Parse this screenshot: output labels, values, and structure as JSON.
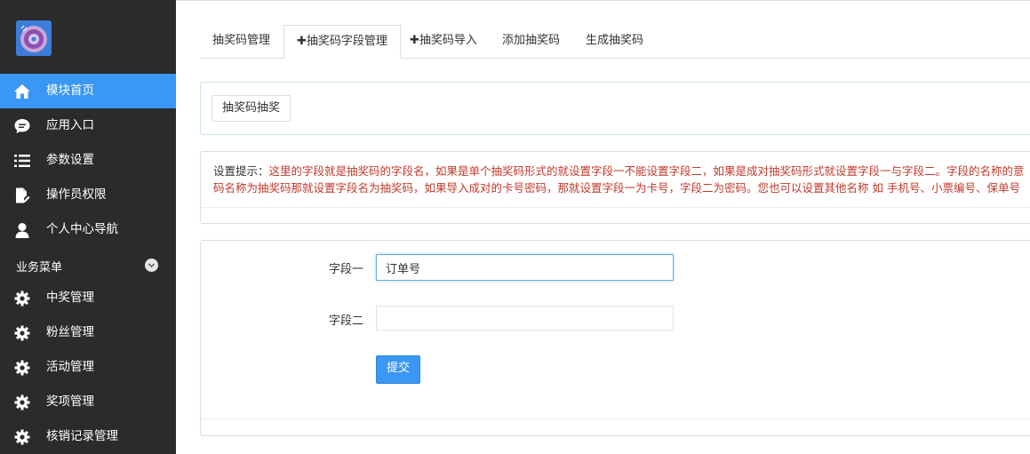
{
  "sidebar": {
    "items": [
      {
        "label": "模块首页",
        "icon": "home-icon",
        "active": true
      },
      {
        "label": "应用入口",
        "icon": "chat-icon"
      },
      {
        "label": "参数设置",
        "icon": "list-icon"
      },
      {
        "label": "操作员权限",
        "icon": "edit-doc-icon"
      },
      {
        "label": "个人中心导航",
        "icon": "user-icon"
      }
    ],
    "group": {
      "label": "业务菜单",
      "toggle_icon": "chevron-down-icon"
    },
    "group_items": [
      {
        "label": "中奖管理",
        "icon": "gear-icon"
      },
      {
        "label": "粉丝管理",
        "icon": "gear-icon"
      },
      {
        "label": "活动管理",
        "icon": "gear-icon"
      },
      {
        "label": "奖项管理",
        "icon": "gear-icon"
      },
      {
        "label": "核销记录管理",
        "icon": "gear-icon"
      }
    ]
  },
  "tabs": [
    {
      "label": "抽奖码管理"
    },
    {
      "label": "抽奖码字段管理",
      "plus": "✚",
      "active": true
    },
    {
      "label": "抽奖码导入",
      "plus": "✚"
    },
    {
      "label": "添加抽奖码"
    },
    {
      "label": "生成抽奖码"
    }
  ],
  "subbar": {
    "button_label": "抽奖码抽奖"
  },
  "hint": {
    "prefix": "设置提示：",
    "line1": "这里的字段就是抽奖码的字段名，如果是单个抽奖码形式的就设置字段一不能设置字段二，如果是成对抽奖码形式就设置字段一与字段二。字段的名称的意",
    "line2": "码名称为抽奖码那就设置字段名为抽奖码，如果导入成对的卡号密码，那就设置字段一为卡号，字段二为密码。您也可以设置其他名称 如 手机号、小票编号、保单号"
  },
  "form": {
    "field1": {
      "label": "字段一",
      "value": "订单号"
    },
    "field2": {
      "label": "字段二",
      "value": ""
    },
    "submit_label": "提交"
  },
  "colors": {
    "sidebar_bg": "#2b2b2b",
    "accent": "#3a97f3",
    "hint_red": "#c0392b"
  }
}
